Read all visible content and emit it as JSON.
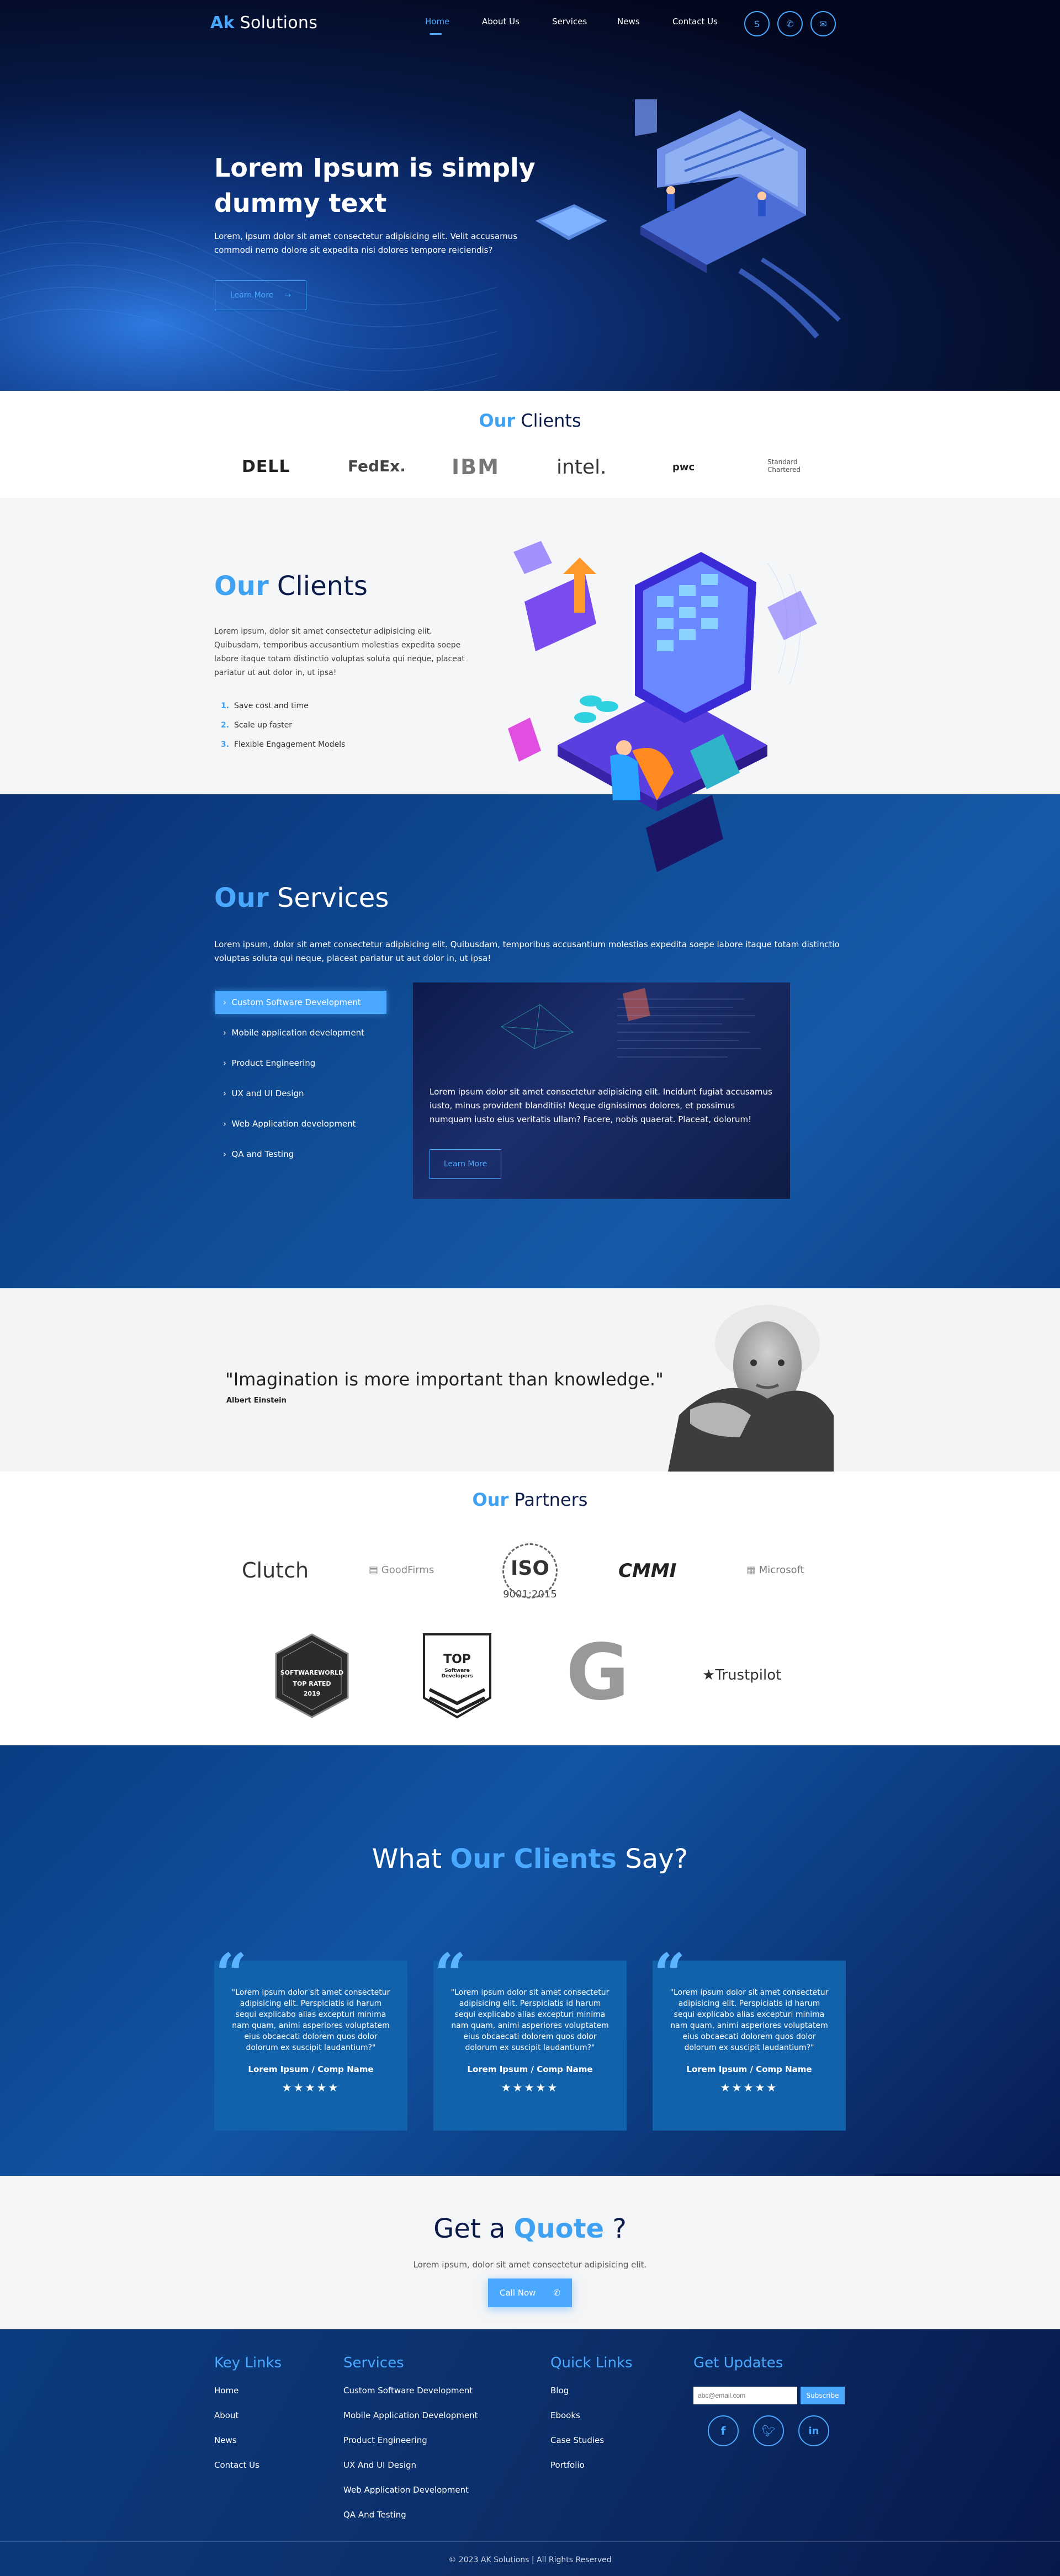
{
  "brand": {
    "prefix": "Ak",
    "name": "Solutions"
  },
  "nav": [
    {
      "label": "Home",
      "active": true
    },
    {
      "label": "About Us",
      "active": false
    },
    {
      "label": "Services",
      "active": false
    },
    {
      "label": "News",
      "active": false
    },
    {
      "label": "Contact Us",
      "active": false
    }
  ],
  "hero": {
    "title": "Lorem Ipsum is simply dummy text",
    "text": "Lorem, ipsum dolor sit amet consectetur adipisicing elit. Velit accusamus commodi nemo dolore sit expedita nisi dolores tempore reiciendis?",
    "button": "Learn More"
  },
  "clients_strip": {
    "title_accent": "Our",
    "title_rest": "Clients",
    "logos": [
      "DELL",
      "FedEx.",
      "IBM",
      "intel.",
      "pwc",
      "Standard Chartered"
    ]
  },
  "our_clients": {
    "title_accent": "Our",
    "title_rest": "Clients",
    "text": "Lorem ipsum, dolor sit amet consectetur adipisicing elit. Quibusdam, temporibus accusantium molestias expedita soepe labore itaque totam distinctio voluptas soluta qui neque, placeat pariatur ut aut dolor in, ut ipsa!",
    "list": [
      "Save cost and time",
      "Scale up faster",
      "Flexible Engagement Models"
    ]
  },
  "services": {
    "title_accent": "Our",
    "title_rest": "Services",
    "text": "Lorem ipsum, dolor sit amet consectetur adipisicing elit. Quibusdam, temporibus accusantium molestias expedita soepe labore itaque totam distinctio voluptas soluta qui neque, placeat pariatur ut aut dolor in, ut ipsa!",
    "items": [
      "Custom Software Development",
      "Mobile application development",
      "Product Engineering",
      "UX and UI Design",
      "Web Application development",
      "QA and Testing"
    ],
    "panel_text": "Lorem ipsum dolor sit amet consectetur adipisicing elit. Incidunt fugiat accusamus iusto, minus provident blanditiis! Neque dignissimos dolores, et possimus numquam iusto eius veritatis ullam? Facere, nobis quaerat. Placeat, dolorum!",
    "panel_button": "Learn More"
  },
  "quote": {
    "text": "\"Imagination is more important than knowledge.\"",
    "author": "Albert Einstein"
  },
  "partners": {
    "title_accent": "Our",
    "title_rest": "Partners",
    "row1": [
      "Clutch",
      "GoodFirms",
      "ISO",
      "9001:2015",
      "CMMI",
      "Microsoft"
    ],
    "row2": [
      "SOFTWAREWORLD",
      "TOP RATED",
      "2019",
      "TOP",
      "Software Developers",
      "G",
      "Trustpilot"
    ]
  },
  "testimonials": {
    "title_pre": "What",
    "title_accent": "Our Clients",
    "title_post": "Say?",
    "cards": [
      {
        "text": "\"Lorem ipsum dolor sit amet consectetur adipisicing elit. Perspiciatis id harum sequi explicabo alias excepturi minima nam quam, animi asperiores voluptatem eius obcaecati dolorem quos dolor dolorum ex suscipit laudantium?\"",
        "name": "Lorem Ipsum / Comp Name",
        "stars": "★★★★★"
      },
      {
        "text": "\"Lorem ipsum dolor sit amet consectetur adipisicing elit. Perspiciatis id harum sequi explicabo alias excepturi minima nam quam, animi asperiores voluptatem eius obcaecati dolorem quos dolor dolorum ex suscipit laudantium?\"",
        "name": "Lorem Ipsum / Comp Name",
        "stars": "★★★★★"
      },
      {
        "text": "\"Lorem ipsum dolor sit amet consectetur adipisicing elit. Perspiciatis id harum sequi explicabo alias excepturi minima nam quam, animi asperiores voluptatem eius obcaecati dolorem quos dolor dolorum ex suscipit laudantium?\"",
        "name": "Lorem Ipsum / Comp Name",
        "stars": "★★★★★"
      }
    ]
  },
  "get_quote": {
    "title_pre": "Get a",
    "title_accent": "Quote",
    "title_post": "?",
    "text": "Lorem ipsum, dolor sit amet consectetur adipisicing elit.",
    "button": "Call Now"
  },
  "footer": {
    "key_links": {
      "title": "Key Links",
      "items": [
        "Home",
        "About",
        "News",
        "Contact Us"
      ]
    },
    "services": {
      "title": "Services",
      "items": [
        "Custom Software Development",
        "Mobile Application Development",
        "Product Engineering",
        "UX And UI Design",
        "Web Application Development",
        "QA And Testing"
      ]
    },
    "quick_links": {
      "title": "Quick Links",
      "items": [
        "Blog",
        "Ebooks",
        "Case Studies",
        "Portfolio"
      ]
    },
    "updates": {
      "title": "Get Updates",
      "email_placeholder": "abc@email.com",
      "subscribe": "Subscribe"
    },
    "copyright": "© 2023 AK Solutions | All Rights Reserved"
  },
  "colors": {
    "accent": "#3ea1f2",
    "navy": "#0b1b4a",
    "footer": "#0b2f6a"
  }
}
